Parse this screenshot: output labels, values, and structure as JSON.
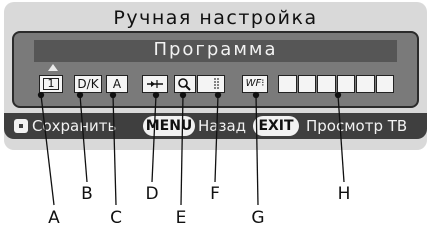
{
  "window": {
    "title": "Ручная настройка"
  },
  "program": {
    "title": "Программа"
  },
  "fields": {
    "program_number": "1",
    "color_system": "D/K",
    "sound_system": "A",
    "skip_icon": "skip-icon",
    "fine_tune_icon": "search-icon",
    "frequency_icon": "frequency-bar-icon",
    "noise_icon": "noise-reduction-icon",
    "noise_label": "WF",
    "name_cells": [
      "",
      "",
      "",
      "",
      "",
      ""
    ]
  },
  "hints": {
    "save": "Сохранить",
    "menu": "MENU",
    "back": "Назад",
    "exit": "EXIT",
    "view_tv": "Просмотр ТВ"
  },
  "callouts": [
    "A",
    "B",
    "C",
    "D",
    "E",
    "F",
    "G",
    "H"
  ]
}
